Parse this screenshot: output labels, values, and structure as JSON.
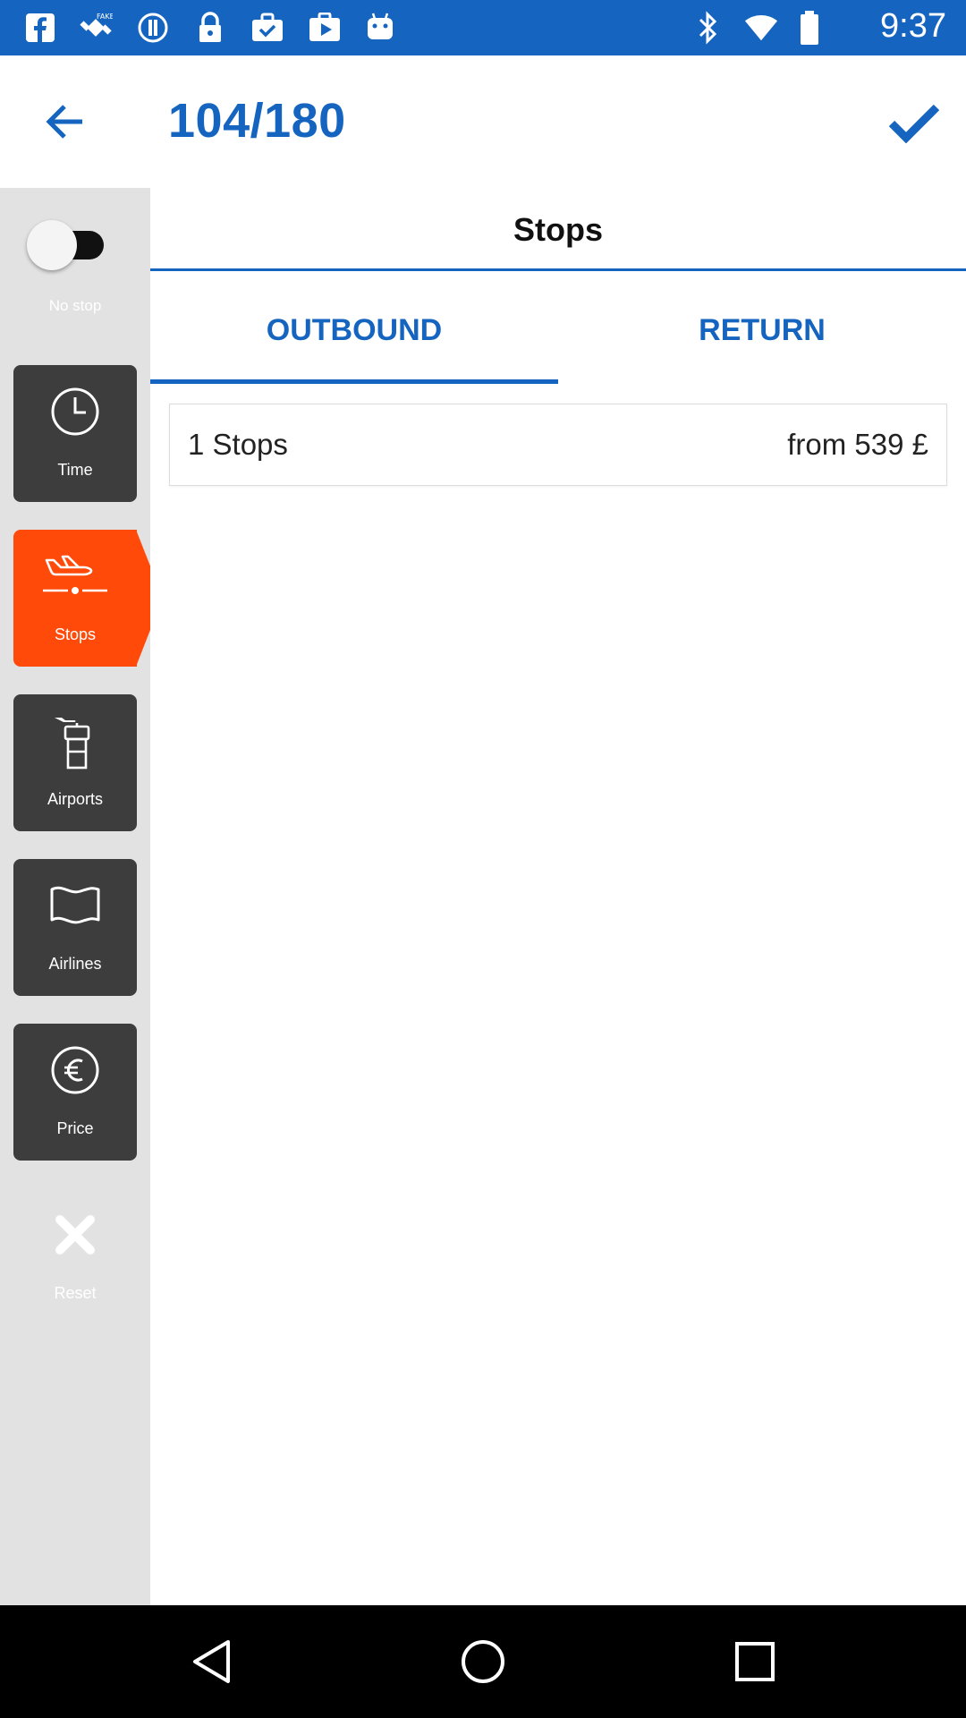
{
  "status_bar": {
    "time": "9:37",
    "icons": [
      "facebook-icon",
      "fake-gps-icon",
      "info-circle-icon",
      "lock-icon",
      "briefcase-check-icon",
      "play-store-icon",
      "android-icon",
      "bluetooth-icon",
      "wifi-icon",
      "battery-icon"
    ]
  },
  "app_bar": {
    "counter": "104/180",
    "back_icon": "arrow-back-icon",
    "confirm_icon": "check-icon"
  },
  "sidebar": {
    "toggle": {
      "label": "No stop",
      "on": false
    },
    "items": [
      {
        "label": "Time",
        "icon": "clock-icon",
        "active": false
      },
      {
        "label": "Stops",
        "icon": "plane-landing-icon",
        "active": true
      },
      {
        "label": "Airports",
        "icon": "control-tower-icon",
        "active": false
      },
      {
        "label": "Airlines",
        "icon": "flag-icon",
        "active": false
      },
      {
        "label": "Price",
        "icon": "euro-icon",
        "active": false
      }
    ],
    "reset": {
      "label": "Reset",
      "icon": "close-icon"
    }
  },
  "main": {
    "title": "Stops",
    "tabs": [
      {
        "label": "OUTBOUND",
        "selected": true
      },
      {
        "label": "RETURN",
        "selected": false
      }
    ],
    "options": [
      {
        "label": "1 Stops",
        "price": "from 539 £"
      }
    ]
  },
  "colors": {
    "primary": "#1565c0",
    "accent": "#ff4a0a",
    "sidebar_bg": "#e2e2e2",
    "sidebar_button": "#3d3d3d"
  }
}
